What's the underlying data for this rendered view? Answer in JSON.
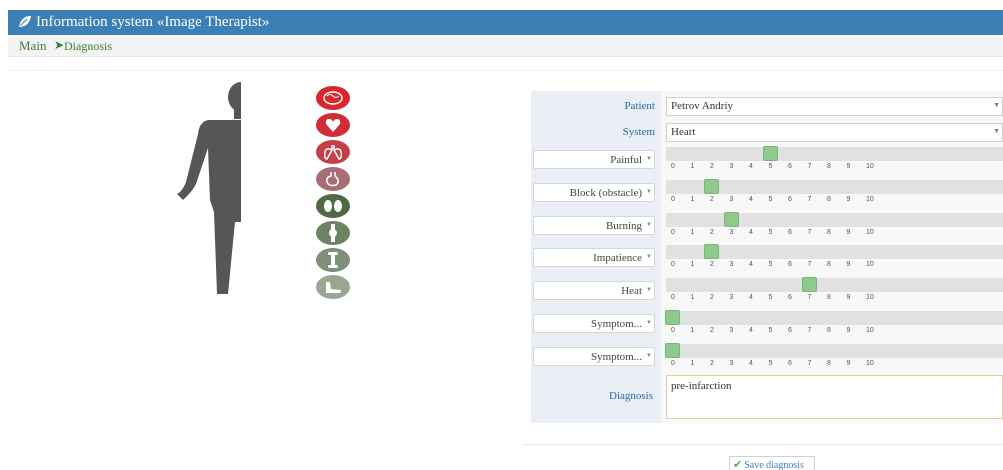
{
  "header": {
    "title": "Information system «Image Therapist»",
    "icon": "leaf-icon"
  },
  "breadcrumb": {
    "main": "Main",
    "separator": "➤",
    "current": "Diagnosis"
  },
  "organs": [
    "brain-icon",
    "heart-icon",
    "lungs-icon",
    "stomach-icon",
    "kidneys-icon",
    "joint-icon",
    "bone-icon",
    "foot-icon"
  ],
  "form": {
    "patient_label": "Patient",
    "patient_value": "Petrov Andriy",
    "system_label": "System",
    "system_value": "Heart",
    "symptoms": [
      {
        "label": "Painful",
        "value": 5
      },
      {
        "label": "Block (obstacle)",
        "value": 2
      },
      {
        "label": "Burning",
        "value": 3
      },
      {
        "label": "Impatience",
        "value": 2
      },
      {
        "label": "Heat",
        "value": 7
      },
      {
        "label": "Symptom...",
        "value": 0
      },
      {
        "label": "Symptom...",
        "value": 0
      }
    ],
    "scale": [
      "0",
      "1",
      "2",
      "3",
      "4",
      "5",
      "6",
      "7",
      "8",
      "9",
      "10"
    ],
    "diagnosis_label": "Diagnosis",
    "diagnosis_value": "pre-infarction",
    "save_label": "Save diagnosis"
  },
  "colors": {
    "header": "#3c7fb4",
    "label_blue": "#2a6aa6",
    "handle": "#8dca8b",
    "organ_red": "#d9262f",
    "organ_grey": "#7f8f78"
  }
}
